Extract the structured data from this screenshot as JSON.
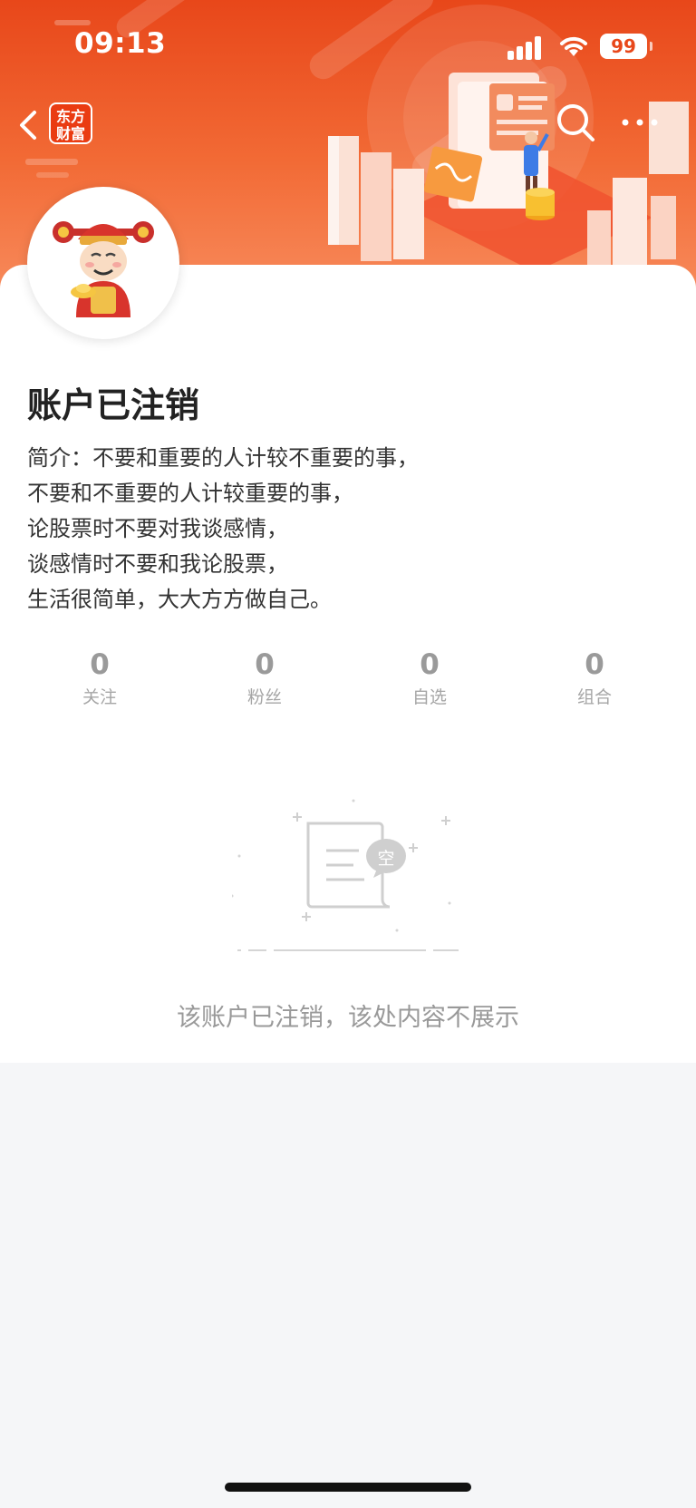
{
  "status_bar": {
    "time": "09:13",
    "battery": "99"
  },
  "nav": {
    "logo_text_line1": "东方",
    "logo_text_line2": "财富"
  },
  "profile": {
    "title": "账户已注销",
    "bio_lines": [
      "简介：不要和重要的人计较不重要的事，",
      "不要和不重要的人计较重要的事，",
      "论股票时不要对我谈感情，",
      "谈感情时不要和我论股票，",
      "生活很简单，大大方方做自己。"
    ]
  },
  "stats": [
    {
      "value": "0",
      "label": "关注"
    },
    {
      "value": "0",
      "label": "粉丝"
    },
    {
      "value": "0",
      "label": "自选"
    },
    {
      "value": "0",
      "label": "组合"
    }
  ],
  "empty_state": {
    "badge": "空",
    "message": "该账户已注销，该处内容不展示"
  },
  "colors": {
    "banner": "#f26a35",
    "brand": "#ea3c12",
    "muted": "#999999"
  },
  "icons": [
    "back-icon",
    "search-icon",
    "more-icon",
    "signal-icon",
    "wifi-icon",
    "battery-icon"
  ]
}
